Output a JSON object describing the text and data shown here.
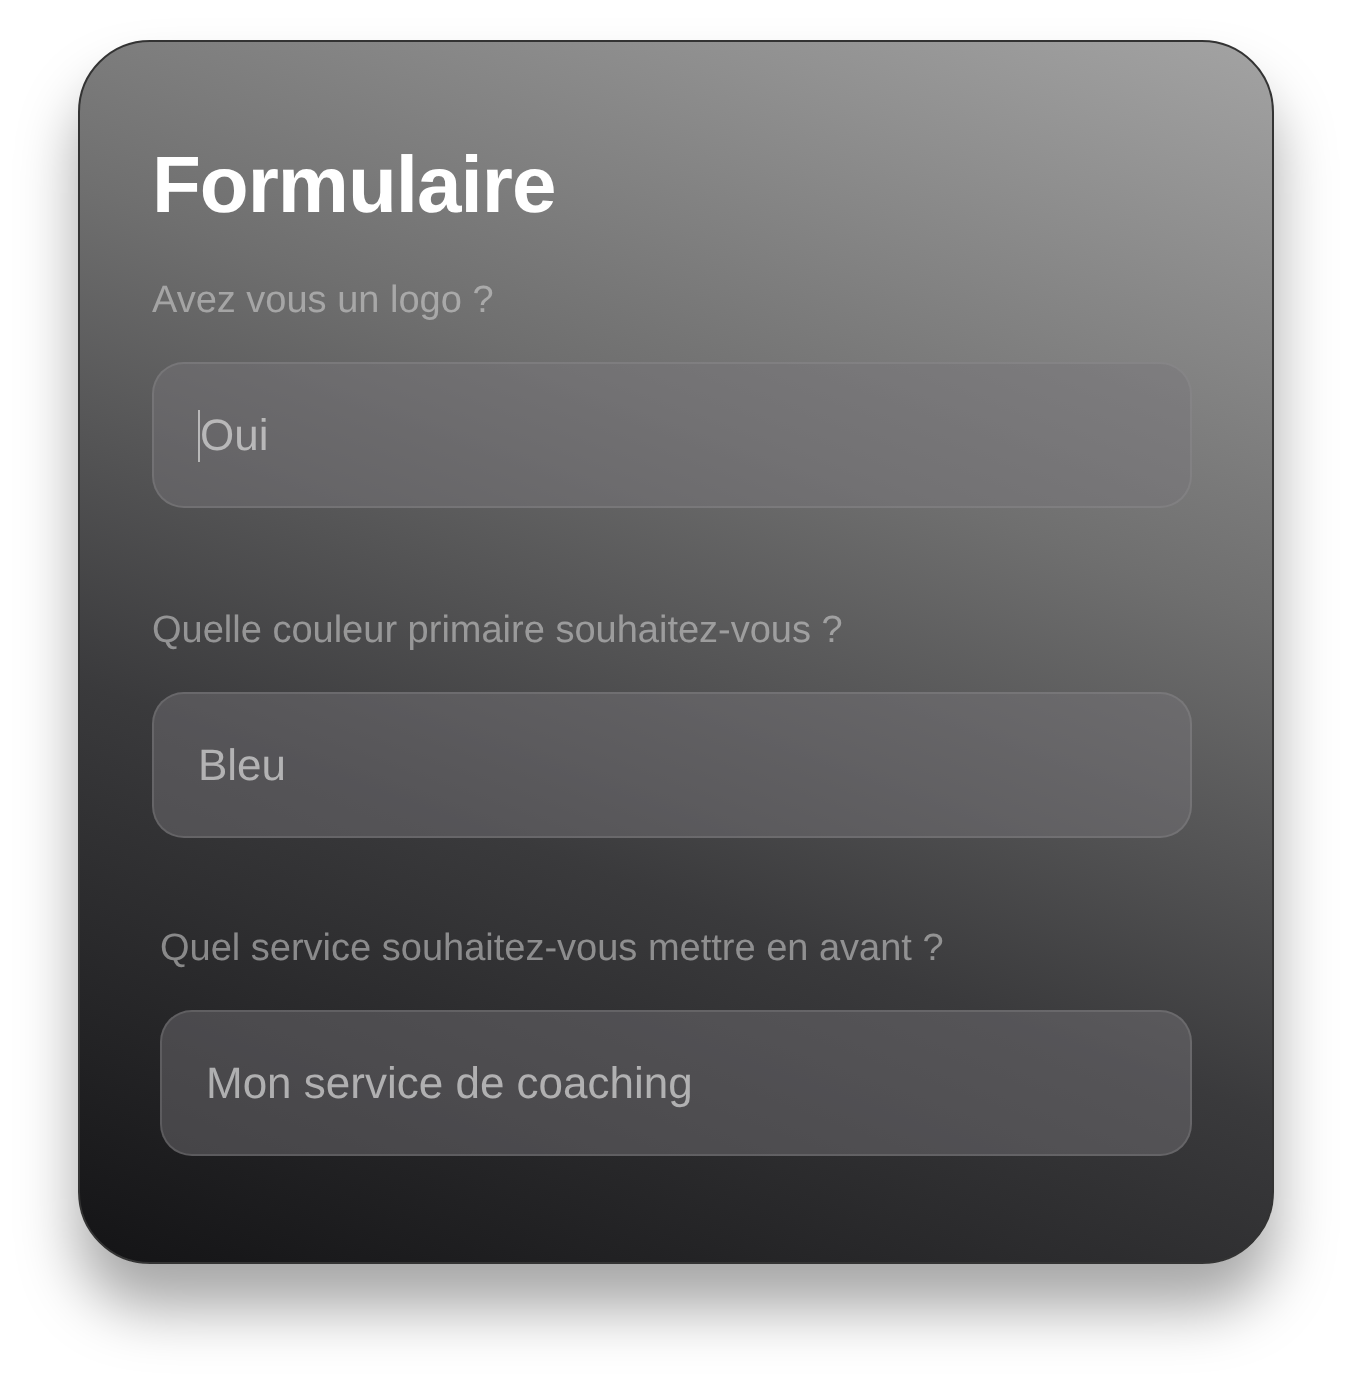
{
  "title": "Formulaire",
  "fields": [
    {
      "label": "Avez vous un logo ?",
      "value": "Oui",
      "focused": true
    },
    {
      "label": "Quelle couleur primaire souhaitez-vous ?",
      "value": "Bleu",
      "focused": false
    },
    {
      "label": "Quel service souhaitez-vous mettre en avant ?",
      "value": "Mon service de coaching",
      "focused": false
    }
  ]
}
